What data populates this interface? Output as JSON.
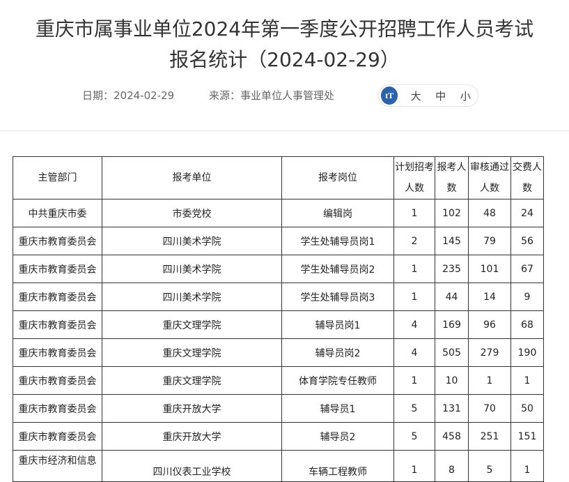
{
  "article": {
    "title_line1": "重庆市属事业单位2024年第一季度公开招聘工作人员考试",
    "title_line2": "报名统计（2024-02-29）",
    "date": "日期：2024-02-29",
    "source": "来源：事业单位人事管理处"
  },
  "font_controls": {
    "icon": "tT",
    "large": "大",
    "medium": "中",
    "small": "小"
  },
  "table": {
    "headers": [
      "主管部门",
      "报考单位",
      "报考岗位",
      "计划招考人数",
      "报考人数",
      "审核通过人数",
      "交费人数"
    ],
    "rows": [
      [
        "中共重庆市委",
        "市委党校",
        "编辑岗",
        "1",
        "102",
        "48",
        "24"
      ],
      [
        "重庆市教育委员会",
        "四川美术学院",
        "学生处辅导员岗1",
        "2",
        "145",
        "79",
        "56"
      ],
      [
        "重庆市教育委员会",
        "四川美术学院",
        "学生处辅导员岗2",
        "1",
        "235",
        "101",
        "67"
      ],
      [
        "重庆市教育委员会",
        "四川美术学院",
        "学生处辅导员岗3",
        "1",
        "44",
        "14",
        "9"
      ],
      [
        "重庆市教育委员会",
        "重庆文理学院",
        "辅导员岗1",
        "4",
        "169",
        "96",
        "68"
      ],
      [
        "重庆市教育委员会",
        "重庆文理学院",
        "辅导员岗2",
        "4",
        "505",
        "279",
        "190"
      ],
      [
        "重庆市教育委员会",
        "重庆文理学院",
        "体育学院专任教师",
        "1",
        "10",
        "1",
        "1"
      ],
      [
        "重庆市教育委员会",
        "重庆开放大学",
        "辅导员1",
        "5",
        "131",
        "70",
        "50"
      ],
      [
        "重庆市教育委员会",
        "重庆开放大学",
        "辅导员2",
        "5",
        "458",
        "251",
        "151"
      ],
      [
        "重庆市经济和信息",
        "四川仪表工业学校",
        "车辆工程教师",
        "1",
        "8",
        "5",
        "1"
      ]
    ]
  }
}
